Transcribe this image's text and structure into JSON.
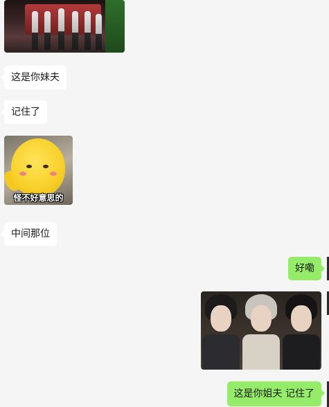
{
  "chat": {
    "messages": [
      {
        "id": "m1",
        "side": "in",
        "type": "image",
        "content": "stage-photo"
      },
      {
        "id": "m2",
        "side": "in",
        "type": "text",
        "text": "这是你妹夫"
      },
      {
        "id": "m3",
        "side": "in",
        "type": "text",
        "text": "记住了"
      },
      {
        "id": "m4",
        "side": "in",
        "type": "sticker",
        "caption": "怪不好意思的"
      },
      {
        "id": "m5",
        "side": "in",
        "type": "text",
        "text": "中间那位"
      },
      {
        "id": "m6",
        "side": "out",
        "type": "text",
        "text": "好嘞"
      },
      {
        "id": "m7",
        "side": "out",
        "type": "image",
        "content": "three-portraits-photo"
      },
      {
        "id": "m8",
        "side": "out",
        "type": "text",
        "text": "这是你姐夫 记住了"
      }
    ]
  },
  "colors": {
    "background": "#f5f5f5",
    "incoming_bubble": "#ffffff",
    "outgoing_bubble": "#95ec69"
  }
}
